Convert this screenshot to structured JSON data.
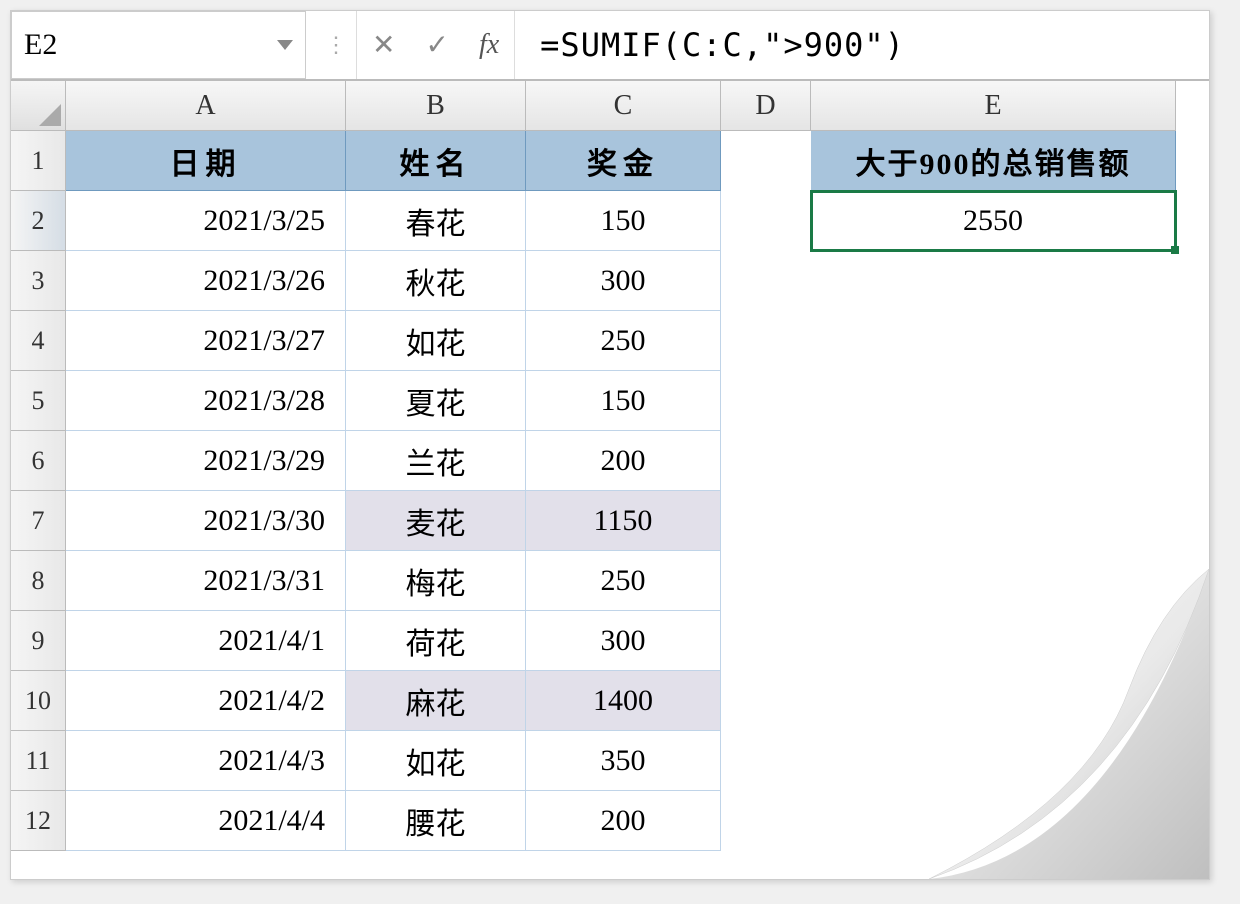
{
  "name_box": "E2",
  "formula": "=SUMIF(C:C,\">900\")",
  "columns": [
    "A",
    "B",
    "C",
    "D",
    "E"
  ],
  "row_numbers": [
    1,
    2,
    3,
    4,
    5,
    6,
    7,
    8,
    9,
    10,
    11,
    12
  ],
  "table": {
    "headers": {
      "A": "日期",
      "B": "姓名",
      "C": "奖金"
    },
    "rows": [
      {
        "date": "2021/3/25",
        "name": "春花",
        "bonus": "150",
        "hl": false
      },
      {
        "date": "2021/3/26",
        "name": "秋花",
        "bonus": "300",
        "hl": false
      },
      {
        "date": "2021/3/27",
        "name": "如花",
        "bonus": "250",
        "hl": false
      },
      {
        "date": "2021/3/28",
        "name": "夏花",
        "bonus": "150",
        "hl": false
      },
      {
        "date": "2021/3/29",
        "name": "兰花",
        "bonus": "200",
        "hl": false
      },
      {
        "date": "2021/3/30",
        "name": "麦花",
        "bonus": "1150",
        "hl": true
      },
      {
        "date": "2021/3/31",
        "name": "梅花",
        "bonus": "250",
        "hl": false
      },
      {
        "date": "2021/4/1",
        "name": "荷花",
        "bonus": "300",
        "hl": false
      },
      {
        "date": "2021/4/2",
        "name": "麻花",
        "bonus": "1400",
        "hl": true
      },
      {
        "date": "2021/4/3",
        "name": "如花",
        "bonus": "350",
        "hl": false
      },
      {
        "date": "2021/4/4",
        "name": "腰花",
        "bonus": "200",
        "hl": false
      }
    ]
  },
  "summary": {
    "title": "大于900的总销售额",
    "value": "2550"
  },
  "icons": {
    "cancel": "✕",
    "confirm": "✓",
    "fx": "fx"
  }
}
